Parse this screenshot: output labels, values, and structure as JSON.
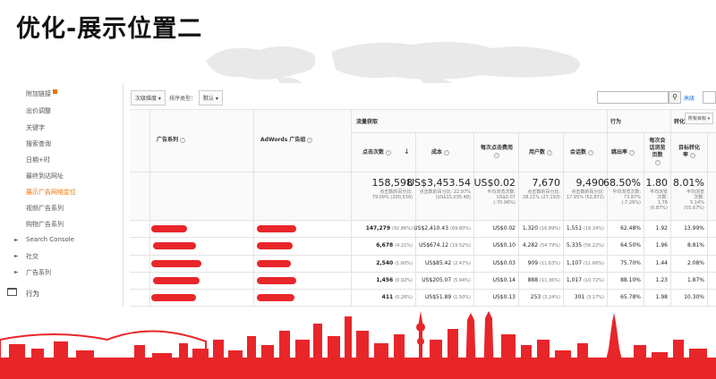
{
  "slide": {
    "title": "优化-展示位置二"
  },
  "sidebar": {
    "items": [
      {
        "label": "附加链接",
        "badge": true,
        "active": false
      },
      {
        "label": "出价调整",
        "active": false
      },
      {
        "label": "关键字",
        "active": false
      },
      {
        "label": "搜索查询",
        "active": false
      },
      {
        "label": "日期+时",
        "active": false
      },
      {
        "label": "最终到达网址",
        "active": false
      },
      {
        "label": "展示广告网络定位",
        "active": true
      },
      {
        "label": "视频广告系列",
        "active": false
      },
      {
        "label": "购物广告系列",
        "active": false
      }
    ],
    "groups": [
      {
        "label": "Search Console",
        "arrow": "►"
      },
      {
        "label": "社交",
        "arrow": "►"
      },
      {
        "label": "广告系列",
        "arrow": "►"
      }
    ],
    "behavior": {
      "label": "行为"
    }
  },
  "toolbar": {
    "secondary_dimension": "次级维度",
    "sort_type_label": "排序类型：",
    "sort_type_value": "默认",
    "advanced_link": "高级",
    "search_icon": "magnifier"
  },
  "table": {
    "groups": {
      "acquisition": "流量获取",
      "behavior": "行为",
      "conversion": "转化",
      "goal_select": "所有目标"
    },
    "columns": {
      "campaign": "广告系列",
      "adgroup": "AdWords 广告组",
      "clicks": "点击次数",
      "cost": "成本",
      "cpc": "每次点击费用",
      "users": "用户数",
      "sessions": "会话数",
      "bounce": "跳出率",
      "pages_line1": "每次会",
      "pages_line2": "话浏览",
      "pages_line3": "页数",
      "conv_line1": "目标转化",
      "conv_line2": "率"
    },
    "summary": {
      "clicks": {
        "value": "158,598",
        "l1": "点击数的百分比:",
        "l2": "79.09% (200,530)"
      },
      "cost": {
        "value": "US$3,453.54",
        "l1": "点击数的百分比: 22.97%",
        "l2": "(US$15,035.48)"
      },
      "cpc": {
        "value": "US$0.02",
        "l1": "平均浏览次数:",
        "l2": "US$0.07",
        "l3": "(-70.96%)"
      },
      "users": {
        "value": "7,670",
        "l1": "点击数的百分比:",
        "l2": "28.21% (27,193)"
      },
      "sessions": {
        "value": "9,490",
        "l1": "点击数的百分比:",
        "l2": "17.95% (52,872)"
      },
      "bounce": {
        "value": "68.50%",
        "l1": "平均浏览次数:",
        "l2": "73.87%",
        "l3": "(-7.26%)"
      },
      "pages": {
        "value": "1.80",
        "l1": "平均浏览",
        "l2": "次数:",
        "l3": "1.78",
        "l4": "(0.87%)"
      },
      "conv": {
        "value": "8.01%",
        "l1": "平均浏览",
        "l2": "次数:",
        "l3": "5.14%",
        "l4": "(55.67%)"
      }
    },
    "rows": [
      {
        "clicks": "147,279",
        "clicks_pct": "(92.86%)",
        "cost": "US$2,410.43",
        "cost_pct": "(69.80%)",
        "cpc": "US$0.02",
        "users": "1,320",
        "users_pct": "(16.89%)",
        "sessions": "1,551",
        "sessions_pct": "(16.34%)",
        "bounce": "62.48%",
        "pages": "1.92",
        "conv": "13.99%"
      },
      {
        "clicks": "6,678",
        "clicks_pct": "(4.21%)",
        "cost": "US$674.12",
        "cost_pct": "(19.52%)",
        "cpc": "US$0.10",
        "users": "4,282",
        "users_pct": "(54.79%)",
        "sessions": "5,335",
        "sessions_pct": "(56.22%)",
        "bounce": "64.50%",
        "pages": "1.96",
        "conv": "8.81%"
      },
      {
        "clicks": "2,540",
        "clicks_pct": "(1.60%)",
        "cost": "US$85.42",
        "cost_pct": "(2.47%)",
        "cpc": "US$0.03",
        "users": "909",
        "users_pct": "(11.63%)",
        "sessions": "1,107",
        "sessions_pct": "(11.66%)",
        "bounce": "75.70%",
        "pages": "1.44",
        "conv": "2.08%"
      },
      {
        "clicks": "1,456",
        "clicks_pct": "(0.92%)",
        "cost": "US$205.07",
        "cost_pct": "(5.94%)",
        "cpc": "US$0.14",
        "users": "888",
        "users_pct": "(11.36%)",
        "sessions": "1,017",
        "sessions_pct": "(10.72%)",
        "bounce": "88.10%",
        "pages": "1.23",
        "conv": "1.87%"
      },
      {
        "clicks": "411",
        "clicks_pct": "(0.26%)",
        "cost": "US$51.89",
        "cost_pct": "(1.50%)",
        "cpc": "US$0.13",
        "users": "253",
        "users_pct": "(3.24%)",
        "sessions": "301",
        "sessions_pct": "(3.17%)",
        "bounce": "65.78%",
        "pages": "1.98",
        "conv": "10.30%"
      }
    ]
  },
  "colors": {
    "accent_red": "#e8262a",
    "active_orange": "#e8710a",
    "link_blue": "#1a73e8"
  }
}
